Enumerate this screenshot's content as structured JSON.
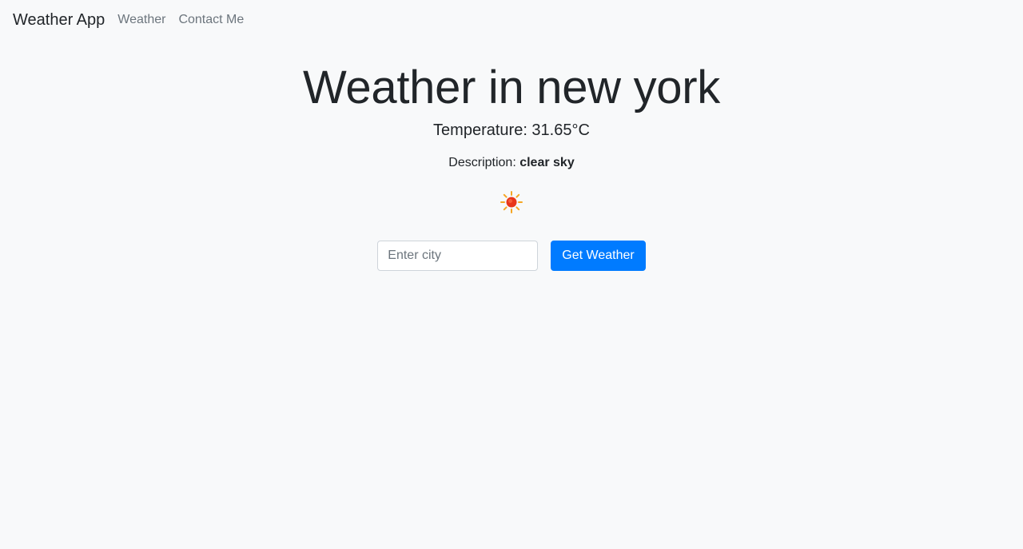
{
  "navbar": {
    "brand": "Weather App",
    "links": [
      {
        "label": "Weather"
      },
      {
        "label": "Contact Me"
      }
    ]
  },
  "main": {
    "title": "Weather in new york",
    "temperature": "Temperature: 31.65°C",
    "description_label": "Description: ",
    "description_value": "clear sky",
    "weather_icon": "sun-icon"
  },
  "form": {
    "city_placeholder": "Enter city",
    "city_value": "",
    "submit_label": "Get Weather"
  },
  "colors": {
    "background": "#f8f9fa",
    "primary": "#007bff",
    "text": "#212529",
    "muted": "#6c757d"
  }
}
